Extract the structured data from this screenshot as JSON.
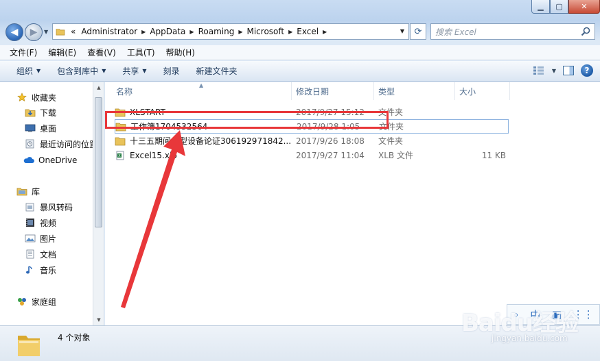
{
  "window": {
    "caption_buttons": [
      "minimize",
      "maximize",
      "close"
    ]
  },
  "address": {
    "prefix": "«",
    "crumbs": [
      "Administrator",
      "AppData",
      "Roaming",
      "Microsoft",
      "Excel"
    ]
  },
  "search": {
    "placeholder": "搜索 Excel"
  },
  "menu": [
    "文件(F)",
    "编辑(E)",
    "查看(V)",
    "工具(T)",
    "帮助(H)"
  ],
  "commands": [
    {
      "label": "组织",
      "dropdown": true
    },
    {
      "label": "包含到库中",
      "dropdown": true
    },
    {
      "label": "共享",
      "dropdown": true
    },
    {
      "label": "刻录",
      "dropdown": false
    },
    {
      "label": "新建文件夹",
      "dropdown": false
    }
  ],
  "nav": {
    "favorites": {
      "label": "收藏夹",
      "items": [
        "下载",
        "桌面",
        "最近访问的位置"
      ]
    },
    "onedrive": "OneDrive",
    "libraries": {
      "label": "库",
      "items": [
        "暴风转码",
        "视频",
        "图片",
        "文档",
        "音乐"
      ]
    },
    "homegroup": "家庭组"
  },
  "columns": {
    "name": "名称",
    "date": "修改日期",
    "type": "类型",
    "size": "大小"
  },
  "files": [
    {
      "name": "XLSTART",
      "date": "2017/9/27 15:12",
      "type": "文件夹",
      "size": "",
      "kind": "folder"
    },
    {
      "name": "工作簿1704532564",
      "date": "2017/9/28 1:05",
      "type": "文件夹",
      "size": "",
      "kind": "folder"
    },
    {
      "name": "十三五期间大型设备论证306192971842...",
      "date": "2017/9/26 18:08",
      "type": "文件夹",
      "size": "",
      "kind": "folder"
    },
    {
      "name": "Excel15.xlb",
      "date": "2017/9/27 11:04",
      "type": "XLB 文件",
      "size": "11 KB",
      "kind": "xlb"
    }
  ],
  "status": {
    "count": "4 个对象"
  },
  "watermark": {
    "logo": "Baidu经验",
    "url": "jingyan.baidu.com"
  },
  "colors": {
    "annotation": "#e8373a",
    "accent": "#2c67b6"
  }
}
